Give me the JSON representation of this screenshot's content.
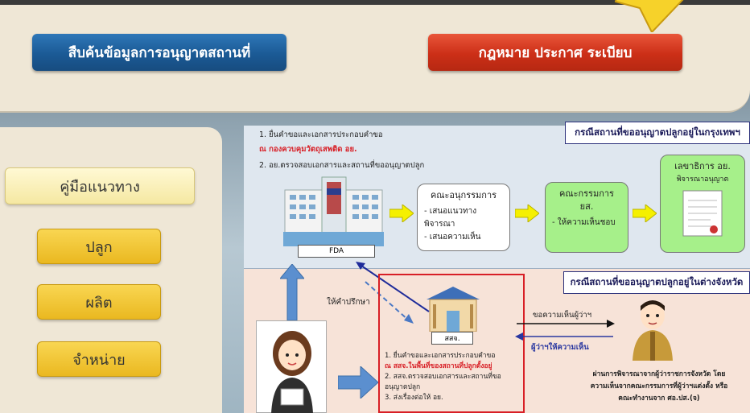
{
  "top": {
    "search_btn": "สืบค้นข้อมูลการอนุญาตสถานที่",
    "law_btn": "กฎหมาย ประกาศ ระเบียบ"
  },
  "left": {
    "guide": "คู่มือแนวทาง",
    "menu": [
      "ปลูก",
      "ผลิต",
      "จำหน่าย"
    ]
  },
  "diagram": {
    "bangkok_case": "กรณีสถานที่ขออนุญาตปลูกอยู่ในกรุงเทพฯ",
    "province_case": "กรณีสถานที่ขออนุญาตปลูกอยู่ในต่างจังหวัด",
    "step1": "1. ยื่นคำขอและเอกสารประกอบคำขอ",
    "step1_place": "ณ กองควบคุมวัตถุเสพติด อย.",
    "step2": "2. อย.ตรวจสอบเอกสารและสถานที่ขออนุญาตปลูก",
    "fda_label": "FDA",
    "subcommittee_title": "คณะอนุกรรมการ",
    "subcommittee_items": [
      "- เสนอแนวทางพิจารณา",
      "- เสนอความเห็น"
    ],
    "committee_title": "คณะกรรมการ",
    "committee_sub": "ยส.",
    "committee_item": "- ให้ความเห็นชอบ",
    "secretary_title": "เลขาธิการ อย.",
    "secretary_sub": "พิจารณาอนุญาต",
    "advice": "ให้คำปรึกษา",
    "office_label": "สสจ.",
    "prov_step1": "1. ยื่นคำขอและเอกสารประกอบคำขอ",
    "prov_step1_place": "ณ สสจ.ในพื้นที่ของสถานที่ปลูกตั้งอยู่",
    "prov_step2": "2. สสจ.ตรวจสอบเอกสารและสถานที่ขออนุญาตปลูก",
    "prov_step3": "3. ส่งเรื่องต่อให้ อย.",
    "ask_opinion": "ขอความเห็นผู้ว่าฯ",
    "governor_opinion": "ผู้ว่าฯให้ความเห็น",
    "governor_note": [
      "ผ่านการพิจารณาจากผู้ว่าราชการจังหวัด โดย",
      "ความเห็นจากคณะกรรมการที่ผู้ว่าฯแต่งตั้ง หรือ",
      "คณะทำงานจาก ศอ.ปส.(จ)"
    ]
  },
  "colors": {
    "blue_button": "#1b5a95",
    "red_button": "#cc2f17",
    "yellow_button": "#eab820",
    "green_card": "#a6f08a",
    "red_frame": "#d81f26"
  }
}
